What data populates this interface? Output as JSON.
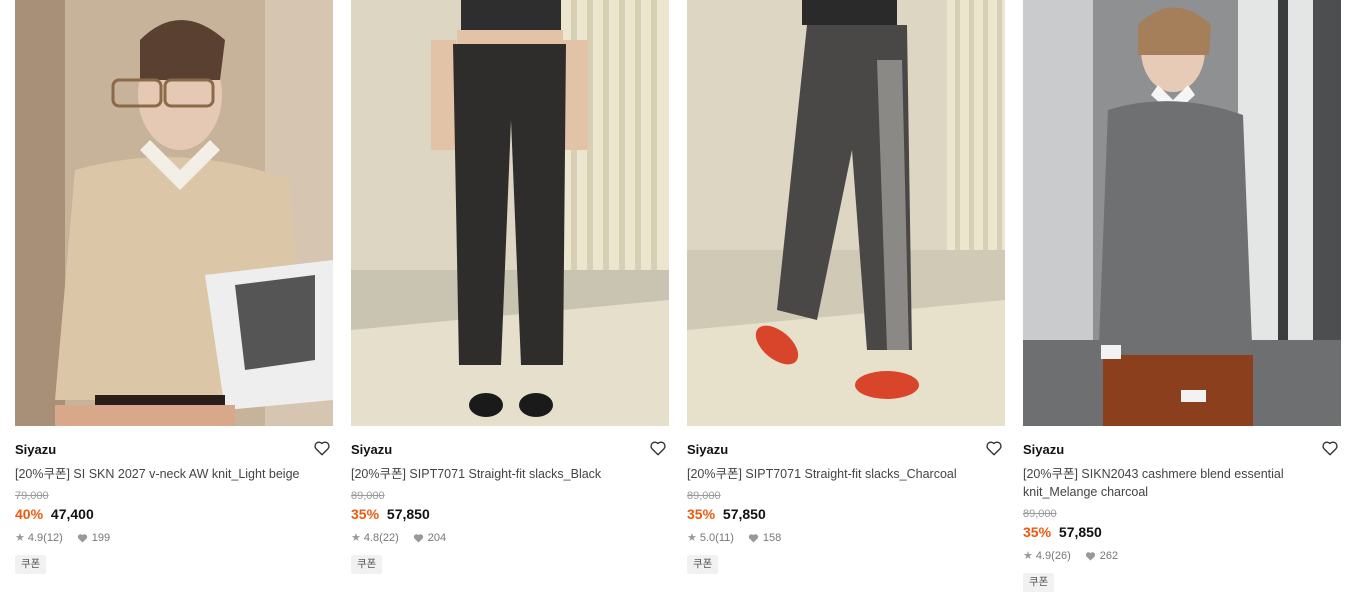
{
  "products": [
    {
      "brand": "Siyazu",
      "name": "[20%쿠폰] SI SKN 2027 v-neck AW knit_Light beige",
      "original_price": "79,000",
      "discount": "40%",
      "price": "47,400",
      "rating": "4.9",
      "reviews": "(12)",
      "likes": "199",
      "badge": "쿠폰",
      "image_icon": "model-beige-knit"
    },
    {
      "brand": "Siyazu",
      "name": "[20%쿠폰] SIPT7071 Straight-fit slacks_Black",
      "original_price": "89,000",
      "discount": "35%",
      "price": "57,850",
      "rating": "4.8",
      "reviews": "(22)",
      "likes": "204",
      "badge": "쿠폰",
      "image_icon": "black-slacks"
    },
    {
      "brand": "Siyazu",
      "name": "[20%쿠폰] SIPT7071 Straight-fit slacks_Charcoal",
      "original_price": "89,000",
      "discount": "35%",
      "price": "57,850",
      "rating": "5.0",
      "reviews": "(11)",
      "likes": "158",
      "badge": "쿠폰",
      "image_icon": "charcoal-slacks"
    },
    {
      "brand": "Siyazu",
      "name": "[20%쿠폰] SIKN2043 cashmere blend essential knit_Melange charcoal",
      "original_price": "89,000",
      "discount": "35%",
      "price": "57,850",
      "rating": "4.9",
      "reviews": "(26)",
      "likes": "262",
      "badge": "쿠폰",
      "image_icon": "model-charcoal-knit"
    }
  ],
  "colors": {
    "discount": "#f0580e",
    "text": "#222222",
    "muted": "#9a9a9a"
  }
}
